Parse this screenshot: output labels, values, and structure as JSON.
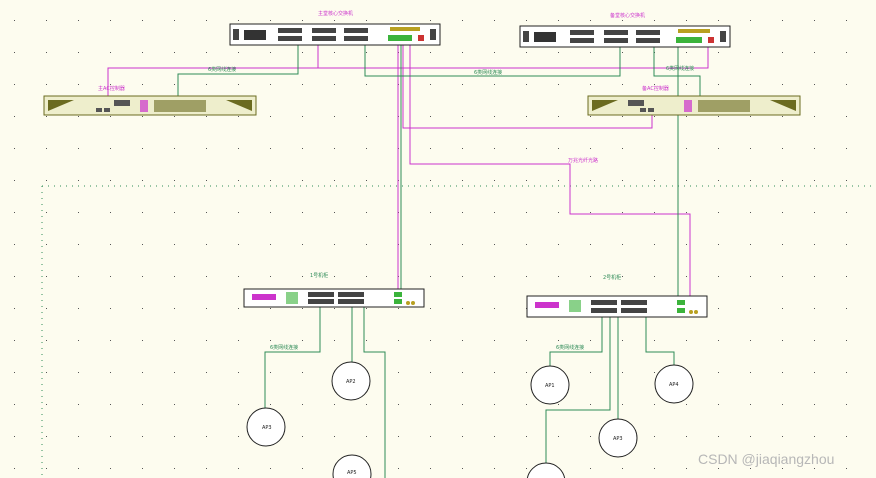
{
  "colors": {
    "background": "#fdfcef",
    "magenta_cable": "#cc33cc",
    "green_cable": "#2e8b57",
    "device_outline": "#222222",
    "ac_body": "#eeeecc",
    "switch_body": "#ffffff",
    "grid_dot": "#2e8b57",
    "port_green": "#3bb33b",
    "port_accent": "#cc33cc",
    "ap_fill": "#ffffff"
  },
  "devices": {
    "core_switch_left": {
      "label": "主堂核心交换机",
      "icon": "rack-switch"
    },
    "core_switch_right": {
      "label": "备堂核心交换机",
      "icon": "rack-switch"
    },
    "ac_left": {
      "label": "主AC控制器",
      "icon": "ac-controller"
    },
    "ac_right": {
      "label": "备AC控制器",
      "icon": "ac-controller"
    },
    "access_switch_1": {
      "label": "1号机柜",
      "icon": "access-switch"
    },
    "access_switch_2": {
      "label": "2号机柜",
      "icon": "access-switch"
    }
  },
  "cable_labels": {
    "left_ac_link": "6类网线连接",
    "middle_link": "6类网线连接",
    "right_ac_link": "6类网线连接",
    "fiber_link": "万兆光纤光路",
    "cab1_link": "6类网线连接",
    "cab2_link": "6类网线连接"
  },
  "access_points": [
    "AP2",
    "AP3",
    "AP5",
    "AP1",
    "AP4",
    "AP3"
  ],
  "watermark": "CSDN @jiaqiangzhou"
}
